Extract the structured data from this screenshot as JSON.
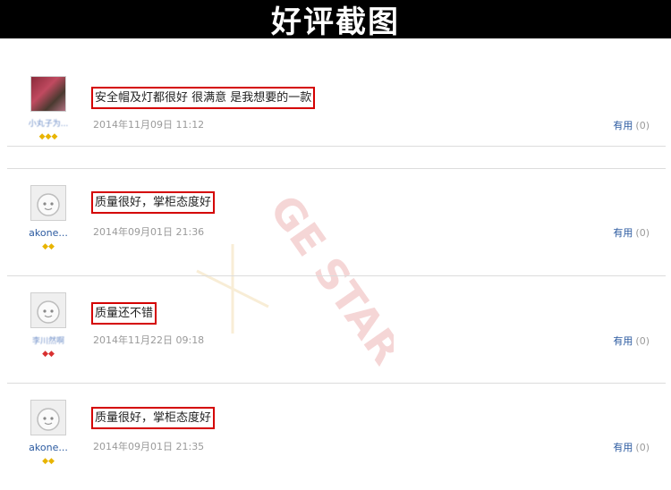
{
  "header": {
    "title": "好评截图"
  },
  "reviews": [
    {
      "username": "小丸子为...",
      "comment": "安全帽及灯都很好 很满意 是我想要的一款",
      "date": "2014年11月09日 11:12",
      "useful_label": "有用",
      "useful_count": "(0)",
      "gems": 3,
      "gem_color": "#e8b400"
    },
    {
      "username": "akone...",
      "comment": "质量很好，掌柜态度好",
      "date": "2014年09月01日 21:36",
      "useful_label": "有用",
      "useful_count": "(0)",
      "gems": 2,
      "gem_color": "#e8b400"
    },
    {
      "username": "李川然啊",
      "comment": "质量还不错",
      "date": "2014年11月22日 09:18",
      "useful_label": "有用",
      "useful_count": "(0)",
      "gems": 2,
      "gem_color": "#d83030"
    },
    {
      "username": "akone...",
      "comment": "质量很好，掌柜态度好",
      "date": "2014年09月01日 21:35",
      "useful_label": "有用",
      "useful_count": "(0)",
      "gems": 2,
      "gem_color": "#e8b400"
    }
  ]
}
